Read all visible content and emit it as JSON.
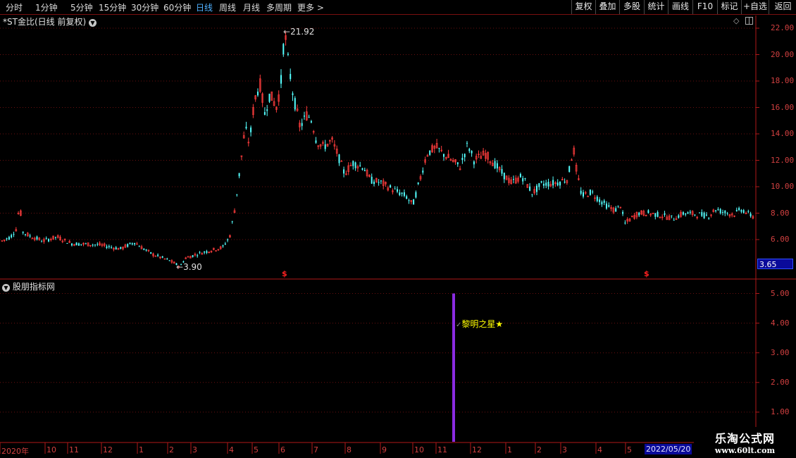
{
  "toolbar": {
    "periods": [
      "分时",
      "1分钟",
      "5分钟",
      "15分钟",
      "30分钟",
      "60分钟",
      "日线",
      "周线",
      "月线",
      "多周期",
      "更多"
    ],
    "more_arrow": ">",
    "buttons": [
      "复权",
      "叠加",
      "多股",
      "统计",
      "画线",
      "F10",
      "标记",
      "+自选",
      "返回"
    ]
  },
  "main_chart": {
    "title": "*ST金比(日线 前复权)",
    "high_label": "21.92",
    "low_label": "3.90",
    "price_badge": "3.65",
    "s_marker": "$",
    "y_ticks": [
      "22.00",
      "20.00",
      "18.00",
      "16.00",
      "14.00",
      "12.00",
      "10.00",
      "8.00",
      "6.00"
    ]
  },
  "indicator": {
    "title": "股朋指标网",
    "signal_text": "黎明之星",
    "check_mark": "✓",
    "star": "★",
    "y_ticks": [
      "5.00",
      "4.00",
      "3.00",
      "2.00",
      "1.00"
    ]
  },
  "time_axis": {
    "labels": [
      "2020年",
      "10",
      "11",
      "12",
      "1",
      "2",
      "3",
      "4",
      "5",
      "6",
      "7",
      "8",
      "9",
      "10",
      "11",
      "12",
      "1",
      "2",
      "3",
      "4",
      "5"
    ],
    "current_date": "2022/05/20"
  },
  "watermark": {
    "title": "乐淘公式网",
    "url": "www.60lt.com"
  },
  "colors": {
    "up": "#ff3c3c",
    "down": "#54ffff",
    "axis": "#b01818",
    "grid": "#6a1010",
    "signal_bar": "#8a2be2",
    "signal_text": "#ffff00",
    "badge_bg": "#0a0a9a"
  }
}
